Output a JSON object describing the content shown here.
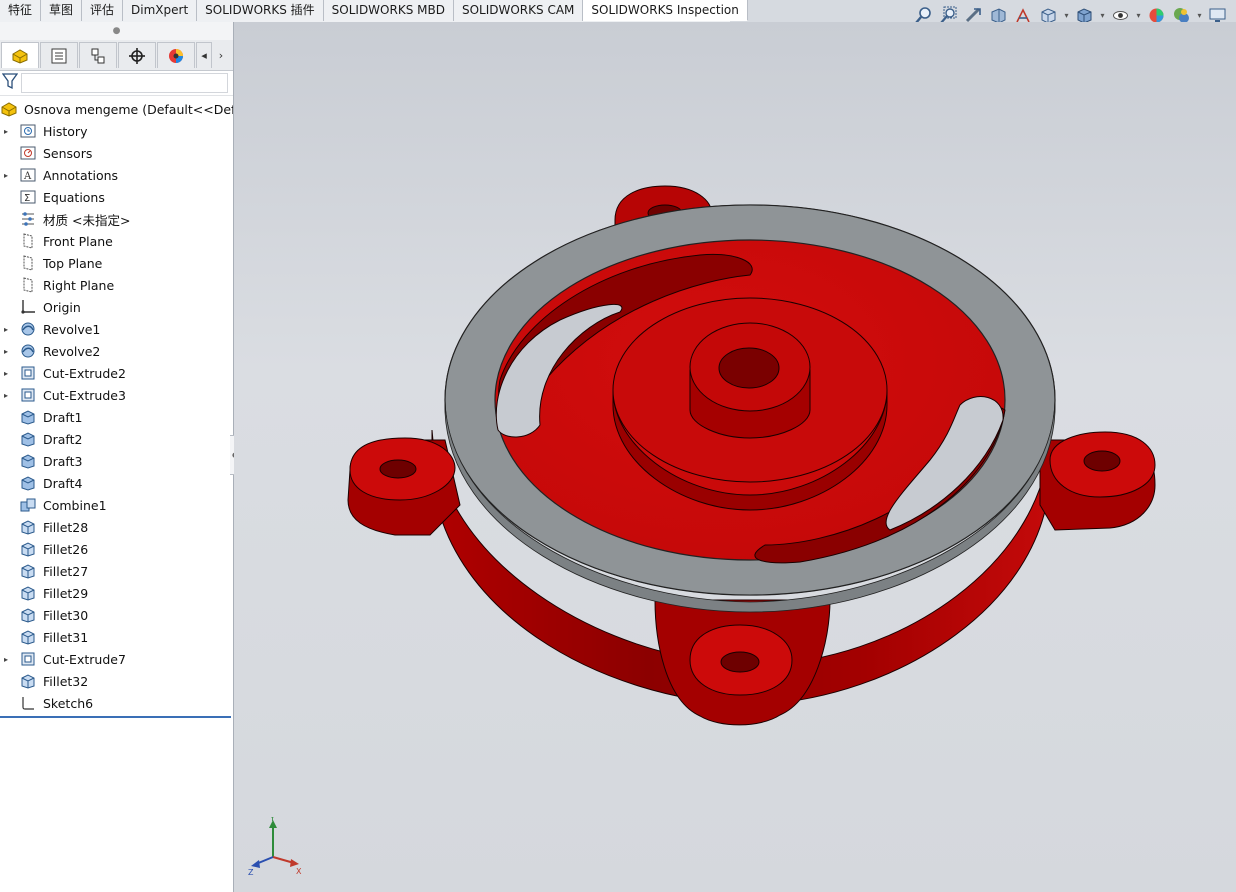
{
  "tabs": [
    {
      "label": "特征"
    },
    {
      "label": "草图"
    },
    {
      "label": "评估"
    },
    {
      "label": "DimXpert"
    },
    {
      "label": "SOLIDWORKS 插件"
    },
    {
      "label": "SOLIDWORKS MBD"
    },
    {
      "label": "SOLIDWORKS CAM"
    },
    {
      "label": "SOLIDWORKS Inspection",
      "active": true
    }
  ],
  "hud_icons": [
    "zoom-to-fit-icon",
    "zoom-to-area-icon",
    "previous-view-icon",
    "section-view-icon",
    "dynamic-annotation-icon",
    "view-orientation-icon",
    "display-style-icon",
    "hide-show-items-icon",
    "edit-appearance-icon",
    "apply-scene-icon",
    "view-settings-icon"
  ],
  "manager_tabs": [
    "featuremanager-icon",
    "propertymanager-icon",
    "configurationmanager-icon",
    "dimxpertmanager-icon",
    "displaymanager-icon"
  ],
  "tree": {
    "root": "Osnova mengeme  (Default<<Default>_Di",
    "items": [
      {
        "label": "History",
        "icon": "history-icon",
        "expand": true
      },
      {
        "label": "Sensors",
        "icon": "sensors-icon",
        "expand": false
      },
      {
        "label": "Annotations",
        "icon": "annotations-icon",
        "expand": true
      },
      {
        "label": "Equations",
        "icon": "equations-icon",
        "expand": false
      },
      {
        "label": "材质 <未指定>",
        "icon": "material-icon",
        "expand": false
      },
      {
        "label": "Front Plane",
        "icon": "plane-icon",
        "expand": false
      },
      {
        "label": "Top Plane",
        "icon": "plane-icon",
        "expand": false
      },
      {
        "label": "Right Plane",
        "icon": "plane-icon",
        "expand": false
      },
      {
        "label": "Origin",
        "icon": "origin-icon",
        "expand": false
      },
      {
        "label": "Revolve1",
        "icon": "revolve-icon",
        "expand": true
      },
      {
        "label": "Revolve2",
        "icon": "revolve-icon",
        "expand": true
      },
      {
        "label": "Cut-Extrude2",
        "icon": "cut-extrude-icon",
        "expand": true
      },
      {
        "label": "Cut-Extrude3",
        "icon": "cut-extrude-icon",
        "expand": true
      },
      {
        "label": "Draft1",
        "icon": "draft-icon",
        "expand": false
      },
      {
        "label": "Draft2",
        "icon": "draft-icon",
        "expand": false
      },
      {
        "label": "Draft3",
        "icon": "draft-icon",
        "expand": false
      },
      {
        "label": "Draft4",
        "icon": "draft-icon",
        "expand": false
      },
      {
        "label": "Combine1",
        "icon": "combine-icon",
        "expand": false
      },
      {
        "label": "Fillet28",
        "icon": "fillet-icon",
        "expand": false
      },
      {
        "label": "Fillet26",
        "icon": "fillet-icon",
        "expand": false
      },
      {
        "label": "Fillet27",
        "icon": "fillet-icon",
        "expand": false
      },
      {
        "label": "Fillet29",
        "icon": "fillet-icon",
        "expand": false
      },
      {
        "label": "Fillet30",
        "icon": "fillet-icon",
        "expand": false
      },
      {
        "label": "Fillet31",
        "icon": "fillet-icon",
        "expand": false
      },
      {
        "label": "Cut-Extrude7",
        "icon": "cut-extrude-icon",
        "expand": true
      },
      {
        "label": "Fillet32",
        "icon": "fillet-icon",
        "expand": false
      },
      {
        "label": "Sketch6",
        "icon": "sketch-icon",
        "expand": false
      }
    ]
  },
  "triad": {
    "x": "X",
    "y": "Y",
    "z": "Z"
  },
  "colors": {
    "part_red": "#c80a0a",
    "part_red_dark": "#8e0000",
    "ring_gray": "#8f9497",
    "viewport_bg": "#d6dae0",
    "tree_endline": "#3a6fb6"
  }
}
